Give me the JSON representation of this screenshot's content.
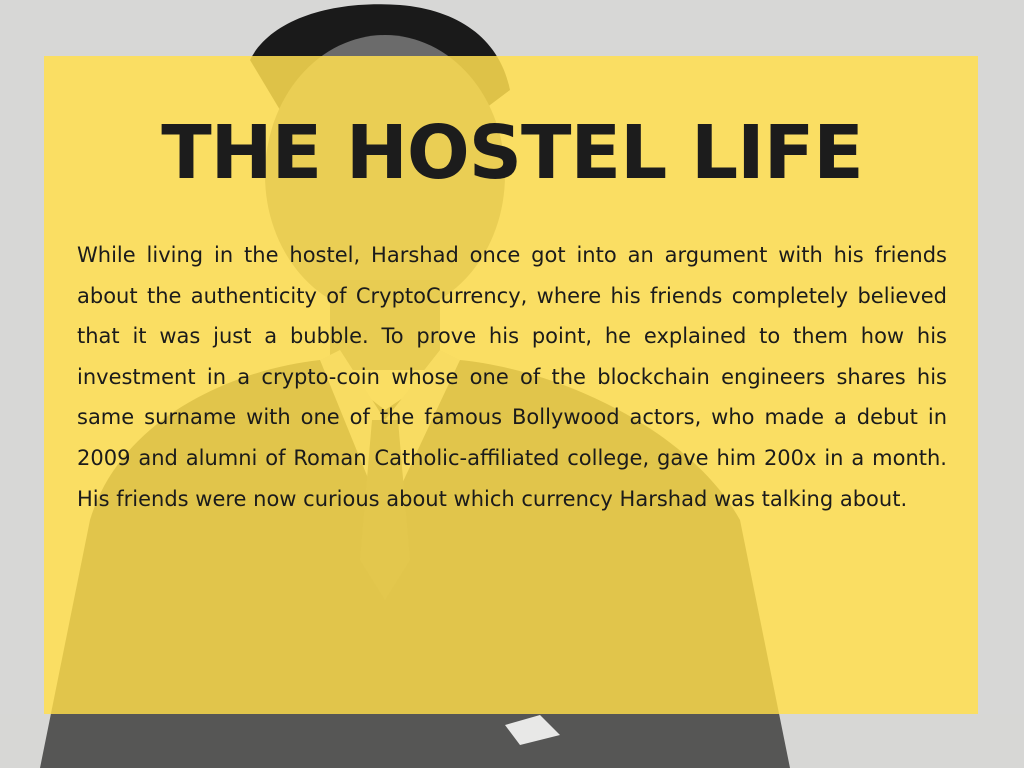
{
  "slide": {
    "title": "THE HOSTEL LIFE",
    "body": "While living in the hostel, Harshad once got into an argument with his friends about the authenticity of CryptoCurrency, where his friends completely believed that it was just a bubble. To prove his point, he explained to them how his investment in a crypto-coin whose one of the blockchain engineers shares his same surname with one of the famous Bollywood actors, who made a debut in 2009 and alumni of Roman Catholic-affiliated college, gave him 200x in a month. His friends were now curious about which currency Harshad was talking about."
  },
  "colors": {
    "panel": "#ffde50",
    "title_text": "#1c1c1c",
    "body_text": "#1b1b1b",
    "photo_background": "#d8d8d6"
  },
  "background_image": {
    "description_icon": "person-in-suit-photo"
  }
}
